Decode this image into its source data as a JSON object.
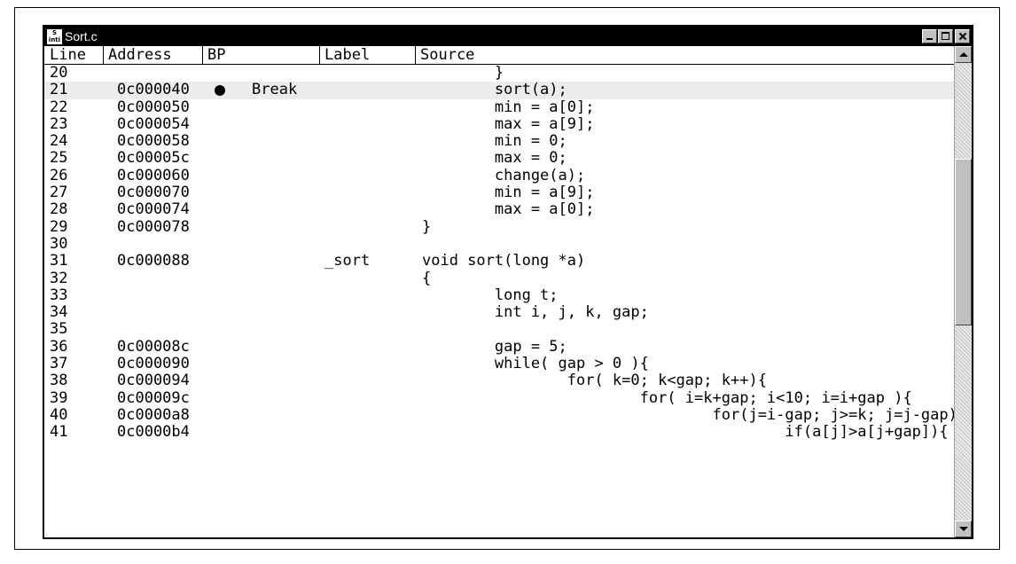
{
  "window": {
    "title": "Sort.c",
    "icon": "app-icon",
    "icon_text_top": "S",
    "icon_text_bottom": "inti"
  },
  "columns": {
    "line": "Line",
    "address": "Address",
    "bp": "BP",
    "label": "Label",
    "source": "Source"
  },
  "rows": [
    {
      "line": "20",
      "address": "",
      "bp": "",
      "bp_text": "",
      "label": "",
      "source": "        }"
    },
    {
      "line": "21",
      "address": "0c000040",
      "bp": "●",
      "bp_text": "Break",
      "label": "",
      "source": "        sort(a);"
    },
    {
      "line": "22",
      "address": "0c000050",
      "bp": "",
      "bp_text": "",
      "label": "",
      "source": "        min = a[0];"
    },
    {
      "line": "23",
      "address": "0c000054",
      "bp": "",
      "bp_text": "",
      "label": "",
      "source": "        max = a[9];"
    },
    {
      "line": "24",
      "address": "0c000058",
      "bp": "",
      "bp_text": "",
      "label": "",
      "source": "        min = 0;"
    },
    {
      "line": "25",
      "address": "0c00005c",
      "bp": "",
      "bp_text": "",
      "label": "",
      "source": "        max = 0;"
    },
    {
      "line": "26",
      "address": "0c000060",
      "bp": "",
      "bp_text": "",
      "label": "",
      "source": "        change(a);"
    },
    {
      "line": "27",
      "address": "0c000070",
      "bp": "",
      "bp_text": "",
      "label": "",
      "source": "        min = a[9];"
    },
    {
      "line": "28",
      "address": "0c000074",
      "bp": "",
      "bp_text": "",
      "label": "",
      "source": "        max = a[0];"
    },
    {
      "line": "29",
      "address": "0c000078",
      "bp": "",
      "bp_text": "",
      "label": "",
      "source": "}"
    },
    {
      "line": "30",
      "address": "",
      "bp": "",
      "bp_text": "",
      "label": "",
      "source": ""
    },
    {
      "line": "31",
      "address": "0c000088",
      "bp": "",
      "bp_text": "",
      "label": "_sort",
      "source": "void sort(long *a)"
    },
    {
      "line": "32",
      "address": "",
      "bp": "",
      "bp_text": "",
      "label": "",
      "source": "{"
    },
    {
      "line": "33",
      "address": "",
      "bp": "",
      "bp_text": "",
      "label": "",
      "source": "        long t;"
    },
    {
      "line": "34",
      "address": "",
      "bp": "",
      "bp_text": "",
      "label": "",
      "source": "        int i, j, k, gap;"
    },
    {
      "line": "35",
      "address": "",
      "bp": "",
      "bp_text": "",
      "label": "",
      "source": ""
    },
    {
      "line": "36",
      "address": "0c00008c",
      "bp": "",
      "bp_text": "",
      "label": "",
      "source": "        gap = 5;"
    },
    {
      "line": "37",
      "address": "0c000090",
      "bp": "",
      "bp_text": "",
      "label": "",
      "source": "        while( gap > 0 ){"
    },
    {
      "line": "38",
      "address": "0c000094",
      "bp": "",
      "bp_text": "",
      "label": "",
      "source": "                for( k=0; k<gap; k++){"
    },
    {
      "line": "39",
      "address": "0c00009c",
      "bp": "",
      "bp_text": "",
      "label": "",
      "source": "                        for( i=k+gap; i<10; i=i+gap ){"
    },
    {
      "line": "40",
      "address": "0c0000a8",
      "bp": "",
      "bp_text": "",
      "label": "",
      "source": "                                for(j=i-gap; j>=k; j=j-gap){"
    },
    {
      "line": "41",
      "address": "0c0000b4",
      "bp": "",
      "bp_text": "",
      "label": "",
      "source": "                                        if(a[j]>a[j+gap]){"
    }
  ],
  "highlighted_line": "21",
  "scrollbar": {
    "position_fraction": 0.33
  }
}
